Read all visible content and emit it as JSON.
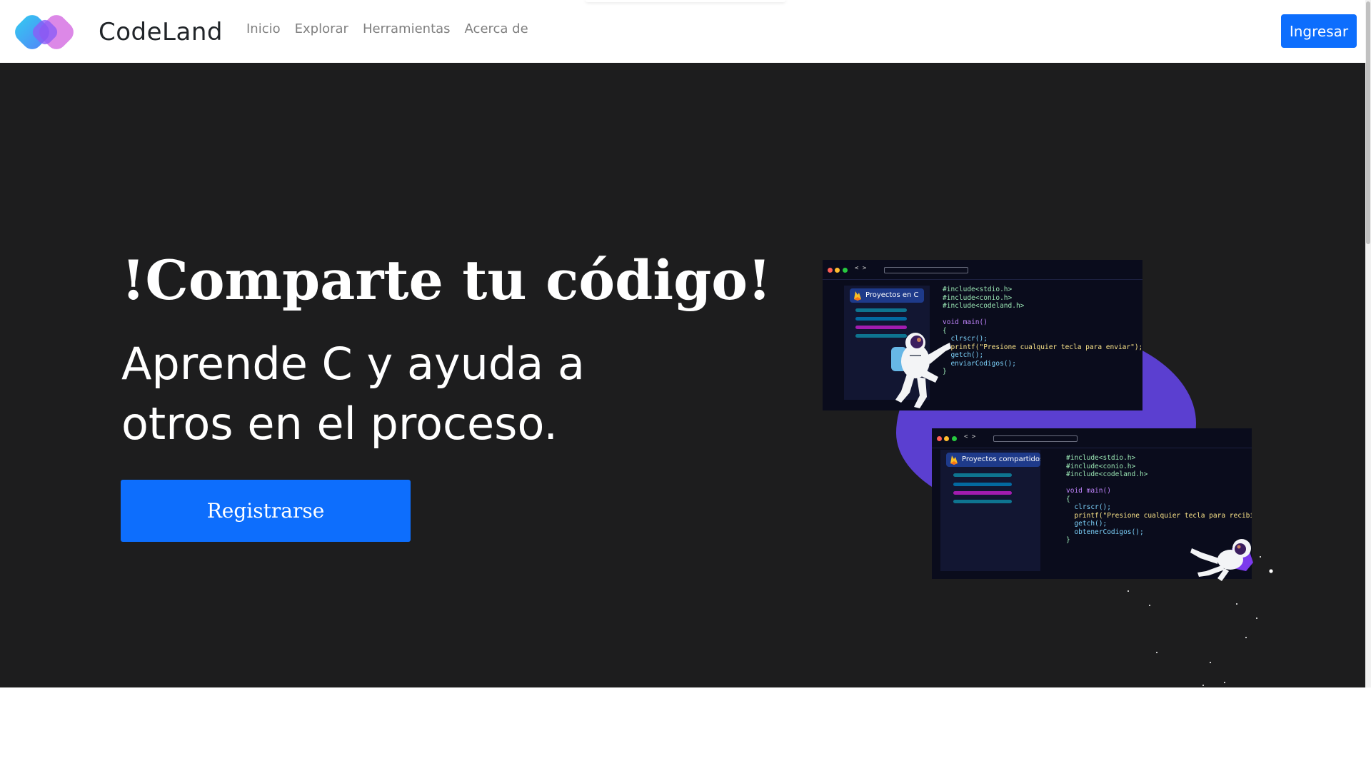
{
  "navbar": {
    "brand_name": "CodeLand",
    "links": [
      "Inicio",
      "Explorar",
      "Herramientas",
      "Acerca de"
    ],
    "login_label": "Ingresar",
    "accent": "#0d6efd"
  },
  "hero": {
    "title": "!Comparte tu código!",
    "subtitle": "Aprende C y ayuda a otros en el proceso.",
    "register_label": "Registrarse",
    "background": "#1d1d1e"
  },
  "illustration": {
    "window1": {
      "panel_title": "Proyectos en C",
      "code_lines": [
        "#include<stdio.h>",
        "#include<conio.h>",
        "#include<codeland.h>",
        "",
        "void main()",
        "{",
        "  clrscr();",
        "  printf(\"Presione cualquier tecla para enviar\");",
        "  getch();",
        "  enviarCodigos();",
        "}"
      ]
    },
    "window2": {
      "panel_title": "Proyectos compartidos",
      "code_lines": [
        "#include<stdio.h>",
        "#include<conio.h>",
        "#include<codeland.h>",
        "",
        "void main()",
        "{",
        "  clrscr();",
        "  printf(\"Presione cualquier tecla para recibir\");",
        "  getch();",
        "  obtenerCodigos();",
        "}"
      ]
    }
  }
}
